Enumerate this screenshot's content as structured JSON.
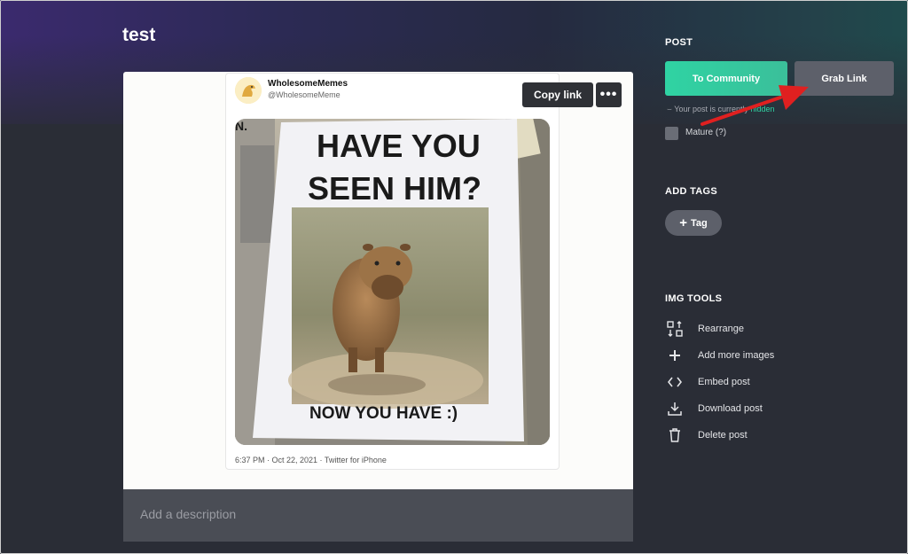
{
  "post": {
    "title": "test",
    "description_placeholder": "Add a description"
  },
  "tweet": {
    "display_name": "WholesomeMemes",
    "handle": "@WholesomeMeme",
    "copy_link_label": "Copy link",
    "more_label": "•••",
    "meta": "6:37 PM · Oct 22, 2021 · Twitter for iPhone",
    "poster": {
      "corner": "N.",
      "line1": "HAVE YOU",
      "line2": "SEEN HIM?",
      "line3": "NOW YOU HAVE :)"
    }
  },
  "sidebar": {
    "post_heading": "POST",
    "to_community_label": "To Community",
    "grab_link_label": "Grab Link",
    "status_prefix": "Your post is currently",
    "status_word": "hidden",
    "mature_label": "Mature (?)",
    "add_tags_heading": "ADD TAGS",
    "tag_label": "Tag",
    "img_tools_heading": "IMG TOOLS",
    "tools": [
      {
        "label": "Rearrange",
        "icon": "rearrange-icon"
      },
      {
        "label": "Add more images",
        "icon": "plus-icon"
      },
      {
        "label": "Embed post",
        "icon": "code-icon"
      },
      {
        "label": "Download post",
        "icon": "download-icon"
      },
      {
        "label": "Delete post",
        "icon": "trash-icon"
      }
    ]
  },
  "colors": {
    "accent": "#2fd3a3",
    "annotation_arrow": "#e02020",
    "button_gray": "#5d606a",
    "page_bg": "#2a2d36"
  }
}
